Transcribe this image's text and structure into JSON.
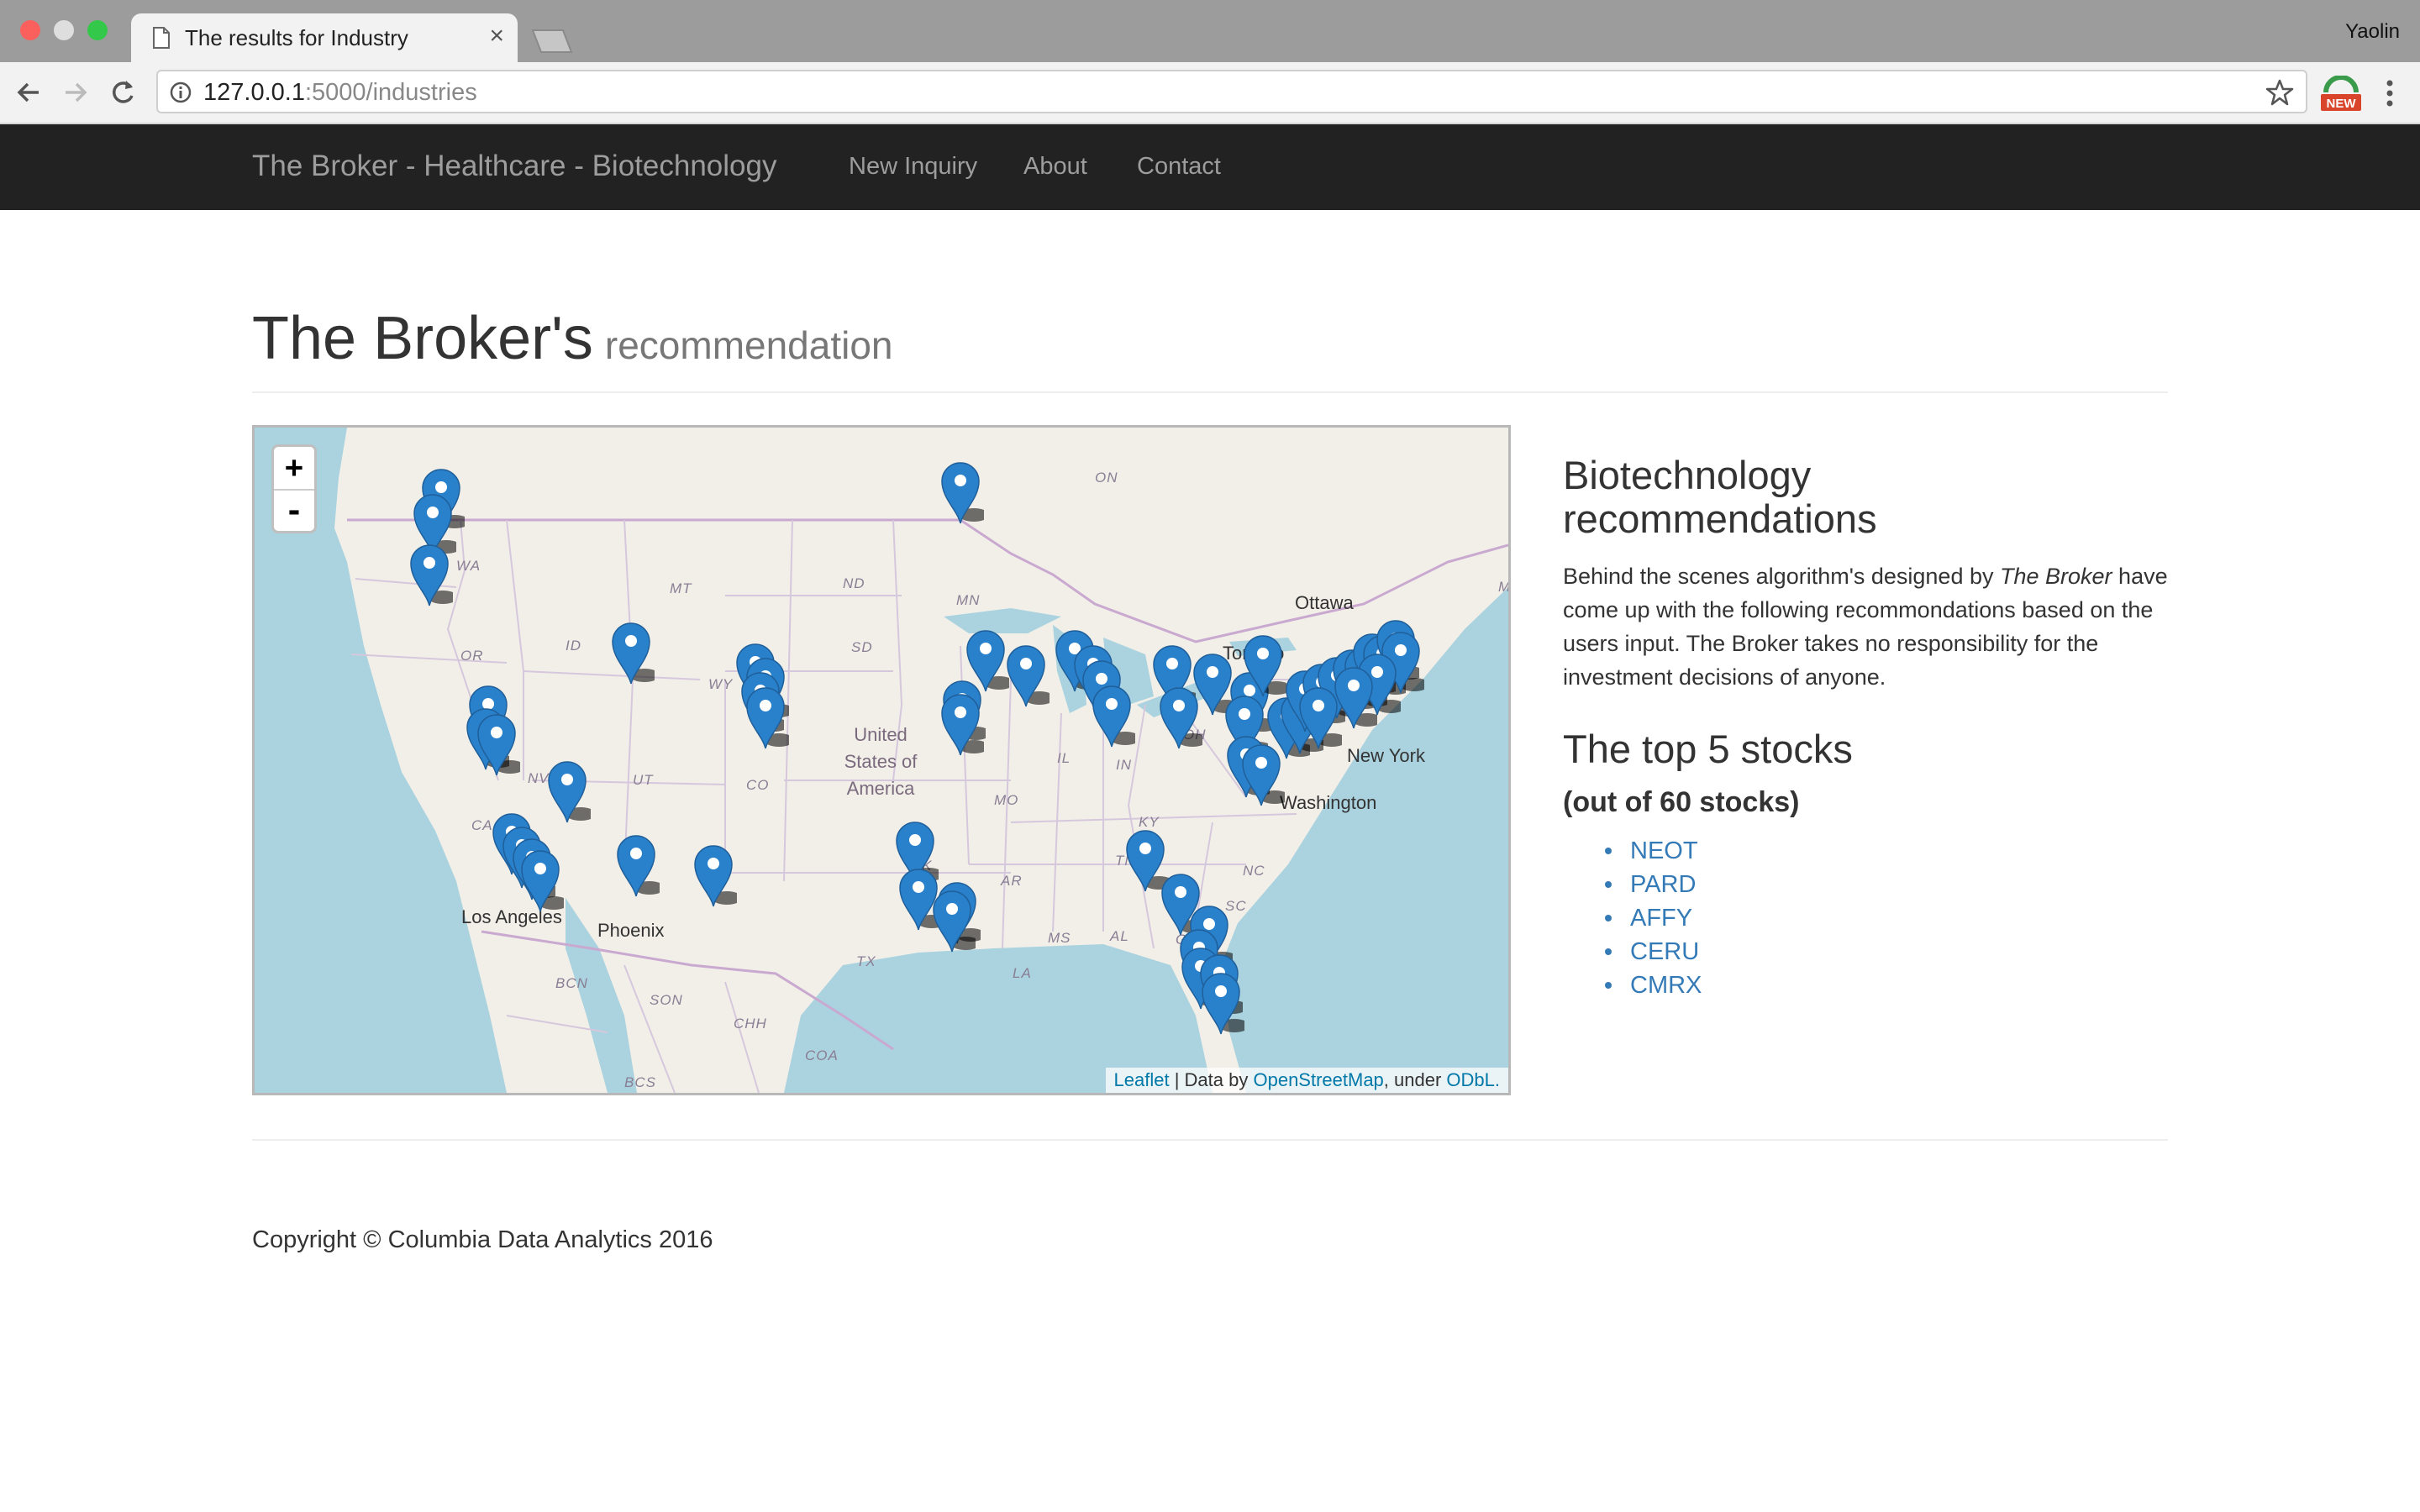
{
  "browser": {
    "tab_title": "The results for Industry",
    "tab_close": "×",
    "profile_name": "Yaolin",
    "url_host": "127.0.0.1",
    "url_rest": ":5000/industries",
    "extension_badge": "NEW"
  },
  "navbar": {
    "brand": "The Broker - Healthcare - Biotechnology",
    "links": [
      "New Inquiry",
      "About",
      "Contact"
    ]
  },
  "header": {
    "title": "The Broker's",
    "subtitle": "recommendation"
  },
  "map": {
    "zoom_in": "+",
    "zoom_out": "-",
    "attribution": {
      "leaflet": "Leaflet",
      "sep": " | Data by ",
      "osm": "OpenStreetMap",
      "under": ", under ",
      "odbl": "ODbL."
    },
    "region_labels": [
      "WA",
      "OR",
      "ID",
      "MT",
      "ND",
      "MN",
      "SD",
      "WY",
      "NV",
      "UT",
      "CO",
      "CA",
      "MO",
      "IL",
      "IN",
      "OH",
      "KY",
      "TN",
      "NC",
      "SC",
      "GA",
      "AL",
      "MS",
      "AR",
      "TX",
      "LA",
      "OK",
      "ON",
      "BCN",
      "SON",
      "CHH",
      "COA",
      "BCS",
      "ME"
    ],
    "city_labels": [
      "Ottawa",
      "Toronto",
      "New York",
      "Washington",
      "Los Angeles",
      "Phoenix"
    ],
    "country_label": "United States of America",
    "marker_color": "#2a81cb"
  },
  "sidebar": {
    "heading": "Biotechnology recommendations",
    "para_part1": "Behind the scenes algorithm's designed by ",
    "para_em": "The Broker",
    "para_part2": " have come up with the following recommondations based on the users input. The Broker takes no responsibility for the investment decisions of anyone.",
    "top_heading": "The top 5 stocks",
    "subheading": "(out of 60 stocks)",
    "stocks": [
      "NEOT",
      "PARD",
      "AFFY",
      "CERU",
      "CMRX"
    ]
  },
  "footer": {
    "copyright": "Copyright © Columbia Data Analytics 2016"
  }
}
